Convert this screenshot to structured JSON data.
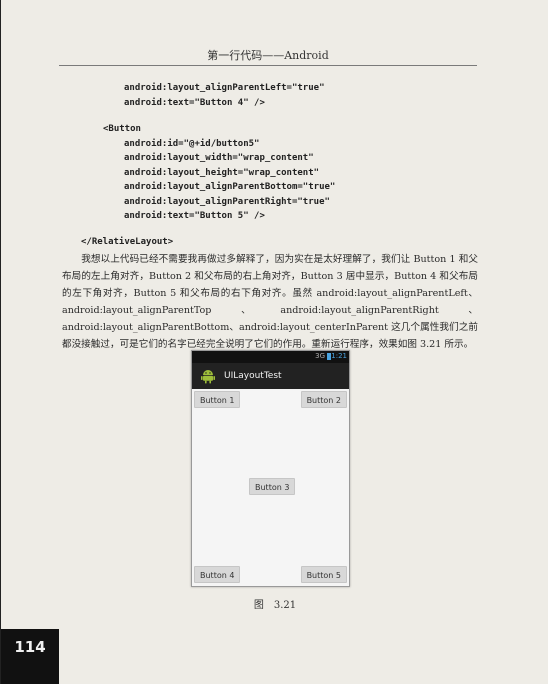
{
  "header": {
    "title": "第一行代码——Android"
  },
  "code_lines": [
    "android:layout_alignParentLeft=\"true\"",
    "android:text=\"Button 4\" />",
    "<Button",
    "android:id=\"@+id/button5\"",
    "android:layout_width=\"wrap_content\"",
    "android:layout_height=\"wrap_content\"",
    "android:layout_alignParentBottom=\"true\"",
    "android:layout_alignParentRight=\"true\"",
    "android:text=\"Button 5\" />",
    "</RelativeLayout>"
  ],
  "body_text": "我想以上代码已经不需要我再做过多解释了，因为实在是太好理解了，我们让 Button 1 和父布局的左上角对齐，Button 2 和父布局的右上角对齐，Button 3 居中显示，Button 4 和父布局的左下角对齐，Button 5 和父布局的右下角对齐。虽然 android:layout_alignParentLeft、android:layout_alignParentTop、android:layout_alignParentRight、android:layout_alignParentBottom、android:layout_centerInParent 这几个属性我们之前都没接触过，可是它们的名字已经完全说明了它们的作用。重新运行程序，效果如图 3.21 所示。",
  "screenshot": {
    "status_time": "1:21",
    "status_signal": "3G",
    "app_title": "UILayoutTest",
    "buttons": {
      "b1": "Button 1",
      "b2": "Button 2",
      "b3": "Button 3",
      "b4": "Button 4",
      "b5": "Button 5"
    }
  },
  "caption": "图　3.21",
  "page_number": "114"
}
